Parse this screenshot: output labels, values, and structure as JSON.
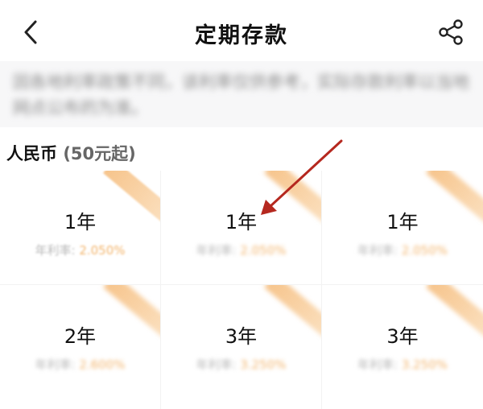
{
  "header": {
    "title": "定期存款",
    "back_icon": "chevron-left-icon",
    "share_icon": "share-icon"
  },
  "notice": {
    "text": "因各地利率政策不同，该利率仅供参考，实际存款利率以当地网点公布的为准。"
  },
  "section": {
    "currency": "人民币",
    "minimum": "(50元起)"
  },
  "products": [
    {
      "term": "1年",
      "rate_label": "年利率:",
      "rate_value": "2.050%"
    },
    {
      "term": "1年",
      "rate_label": "年利率:",
      "rate_value": "2.050%"
    },
    {
      "term": "1年",
      "rate_label": "年利率:",
      "rate_value": "2.050%"
    },
    {
      "term": "2年",
      "rate_label": "年利率:",
      "rate_value": "2.600%"
    },
    {
      "term": "3年",
      "rate_label": "年利率:",
      "rate_value": "3.250%"
    },
    {
      "term": "3年",
      "rate_label": "年利率:",
      "rate_value": "3.250%"
    }
  ],
  "colors": {
    "accent_orange": "#f5ba78",
    "annotation_arrow": "#c0392b"
  }
}
